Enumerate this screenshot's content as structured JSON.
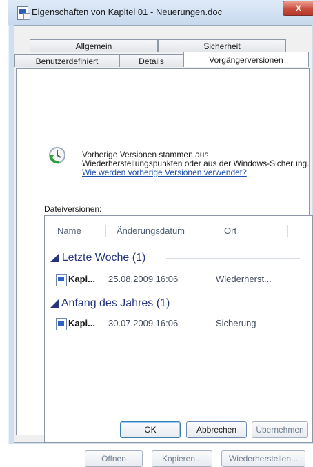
{
  "window": {
    "title": "Eigenschaften von Kapitel 01 - Neuerungen.doc",
    "close_label": "X"
  },
  "tabs": {
    "row1": [
      "Allgemein",
      "Sicherheit"
    ],
    "row2": [
      "Benutzerdefiniert",
      "Details",
      "Vorgängerversionen"
    ],
    "active": "Vorgängerversionen"
  },
  "info": {
    "text": "Vorherige Versionen stammen aus Wiederherstellungspunkten oder aus der Windows-Sicherung.",
    "link": "Wie werden vorherige Versionen verwendet?"
  },
  "file_versions": {
    "label": "Dateiversionen:",
    "columns": [
      "Name",
      "Änderungsdatum",
      "Ort"
    ],
    "groups": [
      {
        "label": "Letzte Woche (1)",
        "items": [
          {
            "name": "Kapi...",
            "date": "25.08.2009 16:06",
            "location": "Wiederherst..."
          }
        ]
      },
      {
        "label": "Anfang des Jahres (1)",
        "items": [
          {
            "name": "Kapi...",
            "date": "30.07.2009 16:06",
            "location": "Sicherung"
          }
        ]
      }
    ]
  },
  "actions": {
    "open": "Öffnen",
    "copy": "Kopieren...",
    "restore": "Wiederherstellen..."
  },
  "dialog_buttons": {
    "ok": "OK",
    "cancel": "Abbrechen",
    "apply": "Übernehmen"
  }
}
